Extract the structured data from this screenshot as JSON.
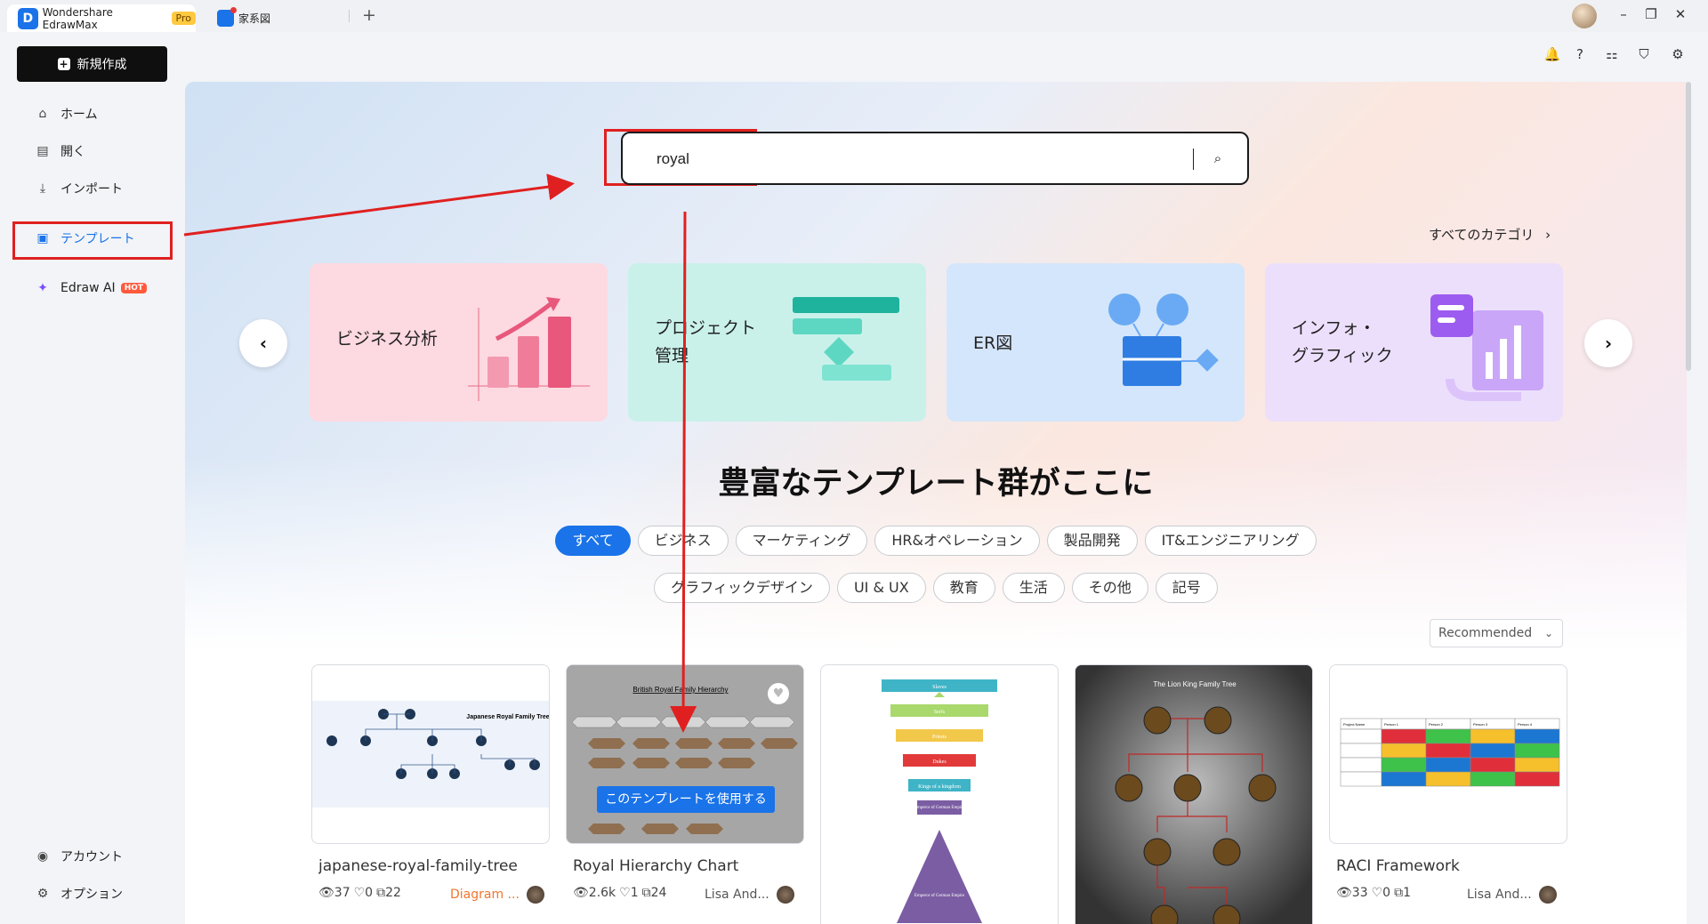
{
  "window": {
    "tab1": {
      "title": "Wondershare EdrawMax",
      "badge": "Pro"
    },
    "tab2": {
      "title": "家系図"
    },
    "new_tab": "+",
    "controls": {
      "minimize": "–",
      "restore": "❐",
      "close": "✕"
    }
  },
  "sidebar": {
    "new_button": "新規作成",
    "nav": {
      "home": "ホーム",
      "open": "開く",
      "import": "インポート",
      "templates": "テンプレート",
      "ai": "Edraw AI",
      "ai_badge": "HOT"
    },
    "bottom": {
      "account": "アカウント",
      "options": "オプション"
    }
  },
  "search": {
    "value": "royal"
  },
  "all_categories": "すべてのカテゴリ",
  "categories": [
    {
      "label": "ビジネス分析"
    },
    {
      "label": "プロジェクト\n管理"
    },
    {
      "label": "ER図"
    },
    {
      "label": "インフォ・\nグラフィック"
    }
  ],
  "headline": "豊富なテンプレート群がここに",
  "filters_row1": [
    "すべて",
    "ビジネス",
    "マーケティング",
    "HR&オペレーション",
    "製品開発",
    "IT&エンジニアリング"
  ],
  "filters_row2": [
    "グラフィックデザイン",
    "UI & UX",
    "教育",
    "生活",
    "その他",
    "記号"
  ],
  "sort": {
    "value": "Recommended"
  },
  "cards": [
    {
      "title": "japanese-royal-family-tree",
      "views": "37",
      "likes": "0",
      "copies": "22",
      "author": "Diagram ...",
      "thumb_title": "Japanese Royal Family Tree"
    },
    {
      "title": "Royal Hierarchy Chart",
      "views": "2.6k",
      "likes": "1",
      "copies": "24",
      "author": "Lisa And...",
      "thumb_title": "British Royal Family Hierarchy",
      "use_button": "このテンプレートを使用する"
    },
    {
      "title": "",
      "thumb_labels": [
        "Slaves",
        "Serfs",
        "Priests",
        "Dukes",
        "Kings of a kingdom",
        "Emperor of German Empire",
        "Emperor of German Empire"
      ]
    },
    {
      "title": "",
      "thumb_title": "The Lion King Family Tree"
    },
    {
      "title": "RACI Framework",
      "views": "33",
      "likes": "0",
      "copies": "1",
      "author": "Lisa And...",
      "thumb_headers": [
        "Project Name",
        "Person 1",
        "Person 2",
        "Person 3",
        "Person 4"
      ]
    }
  ],
  "colors": {
    "accent": "#1a73e8",
    "annotation": "#e02020",
    "hot": "#ff5a3c"
  }
}
